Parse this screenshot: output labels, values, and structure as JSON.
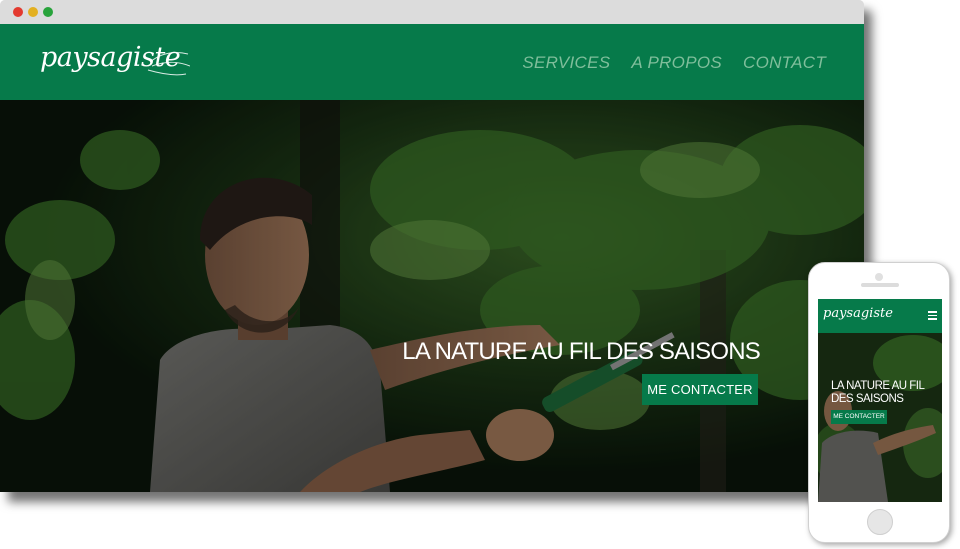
{
  "desktop": {
    "logo_text": "paysagiste",
    "nav": [
      {
        "label": "SERVICES"
      },
      {
        "label": "A PROPOS"
      },
      {
        "label": "CONTACT"
      }
    ],
    "hero": {
      "title": "LA NATURE AU FIL DES SAISONS",
      "cta_label": "ME CONTACTER"
    }
  },
  "mobile": {
    "logo_text": "paysagiste",
    "menu_icon": "hamburger-icon",
    "hero": {
      "title": "LA NATURE AU FIL DES SAISONS",
      "cta_label": "ME CONTACTER"
    }
  },
  "colors": {
    "brand_green": "#067a4a",
    "nav_text": "#7fbe9b",
    "window_chrome": "#dcdcdc"
  }
}
